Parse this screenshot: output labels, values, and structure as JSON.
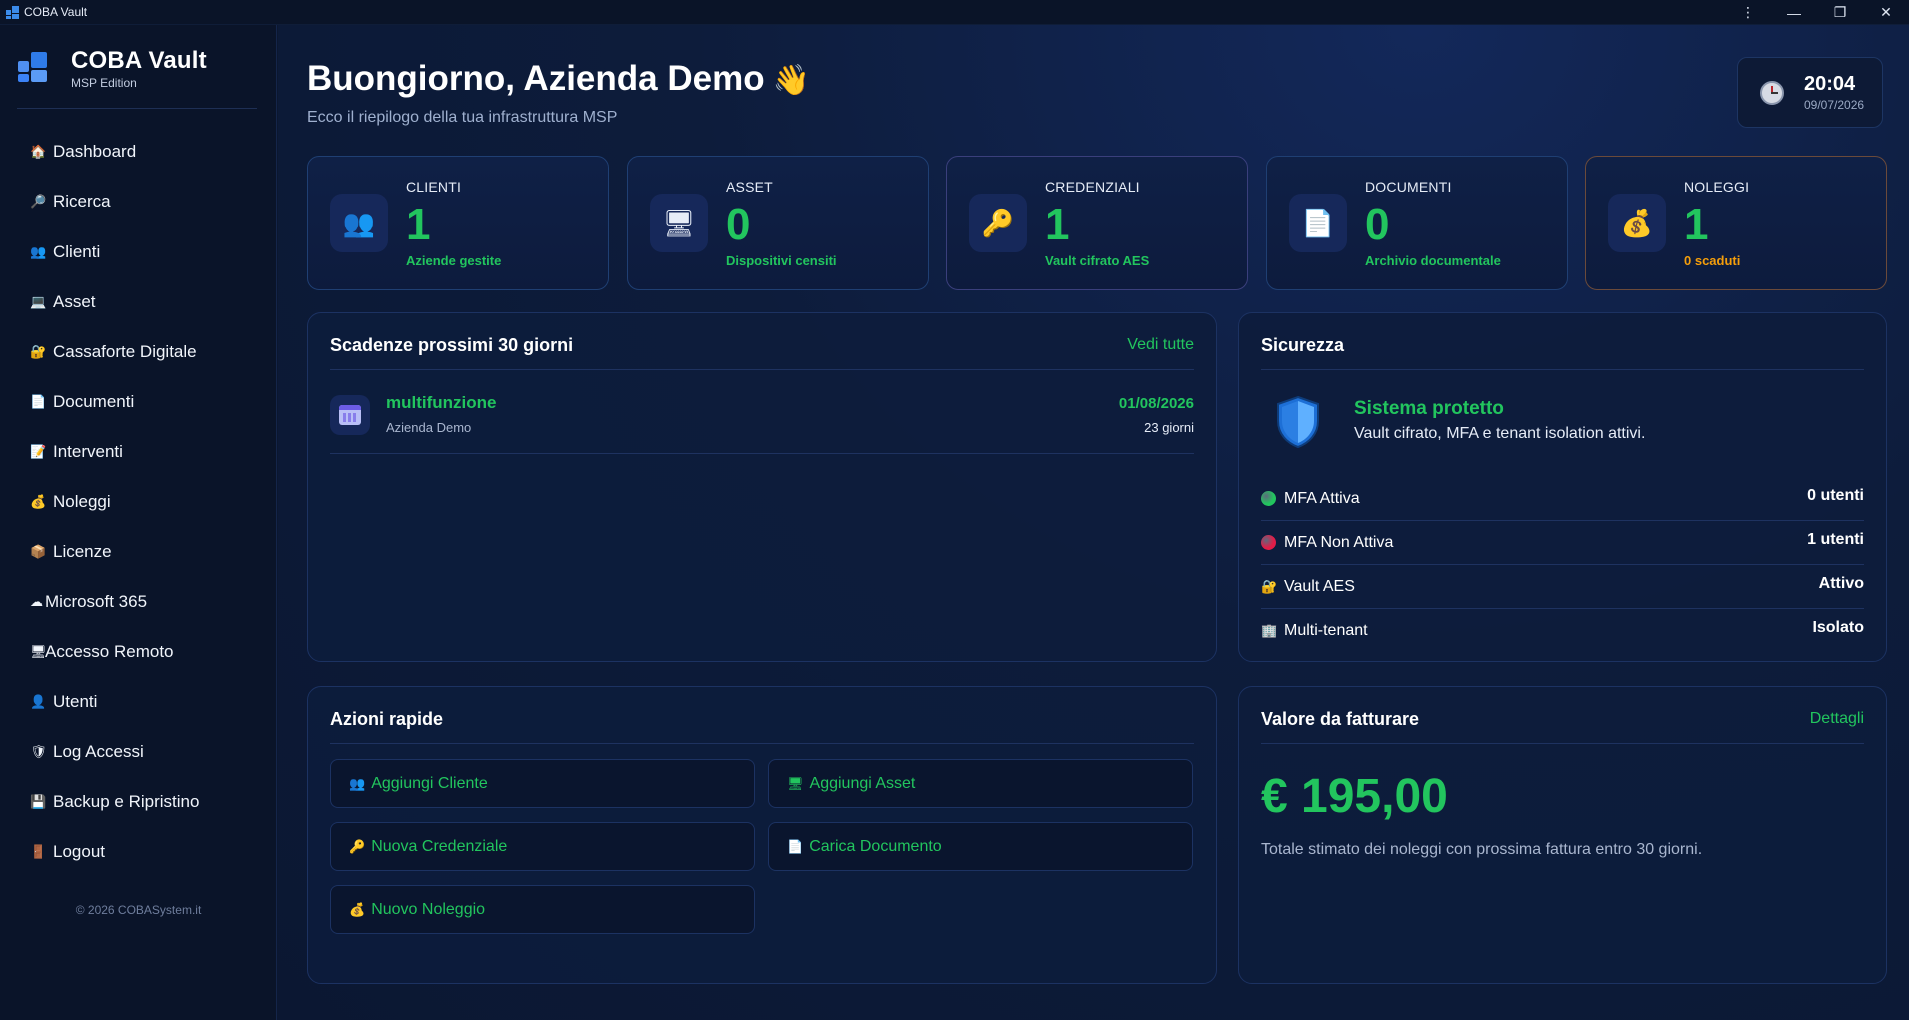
{
  "window": {
    "title": "COBA Vault",
    "controls": [
      {
        "name": "more-options-icon",
        "glyph": "⋮"
      },
      {
        "name": "minimize-icon",
        "glyph": "—"
      },
      {
        "name": "restore-icon",
        "glyph": "❐"
      },
      {
        "name": "close-icon",
        "glyph": "✕"
      }
    ]
  },
  "sidebar": {
    "brand_name": "COBA Vault",
    "brand_edition": "MSP Edition",
    "items": [
      {
        "label": "Dashboard",
        "icon": "🏠",
        "icon_name": "house-icon"
      },
      {
        "label": "Ricerca",
        "icon": "🔎",
        "icon_name": "search-icon"
      },
      {
        "label": "Clienti",
        "icon": "👥",
        "icon_name": "users-icon"
      },
      {
        "label": "Asset",
        "icon": "💻",
        "icon_name": "laptop-icon"
      },
      {
        "label": "Cassaforte Digitale",
        "icon": "🔐",
        "icon_name": "lock-icon"
      },
      {
        "label": "Documenti",
        "icon": "📄",
        "icon_name": "document-icon"
      },
      {
        "label": "Interventi",
        "icon": "📝",
        "icon_name": "memo-icon"
      },
      {
        "label": "Noleggi",
        "icon": "💰",
        "icon_name": "money-bag-icon"
      },
      {
        "label": "Licenze",
        "icon": "📦",
        "icon_name": "package-icon"
      },
      {
        "label": "Microsoft 365",
        "icon": "☁",
        "icon_name": "cloud-icon"
      },
      {
        "label": "Accesso Remoto",
        "icon": "🖥",
        "icon_name": "desktop-icon"
      },
      {
        "label": "Utenti",
        "icon": "👤",
        "icon_name": "user-icon"
      },
      {
        "label": "Log Accessi",
        "icon": "🛡",
        "icon_name": "shield-icon"
      },
      {
        "label": "Backup e Ripristino",
        "icon": "💾",
        "icon_name": "floppy-disk-icon"
      },
      {
        "label": "Logout",
        "icon": "🚪",
        "icon_name": "door-icon"
      }
    ],
    "footer": "© 2026 COBASystem.it"
  },
  "header": {
    "greeting": "Buongiorno, Azienda Demo",
    "wave": "👋",
    "subtitle": "Ecco il riepilogo della tua infrastruttura MSP",
    "clock_time": "20:04",
    "clock_date": "09/07/2026"
  },
  "stats": [
    {
      "label": "CLIENTI",
      "value": "1",
      "sub": "Aziende gestite",
      "icon": "👥",
      "icon_name": "users-icon",
      "variant": "",
      "sub_variant": ""
    },
    {
      "label": "ASSET",
      "value": "0",
      "sub": "Dispositivi censiti",
      "icon": "🖥",
      "icon_name": "desktop-icon",
      "variant": "",
      "sub_variant": ""
    },
    {
      "label": "CREDENZIALI",
      "value": "1",
      "sub": "Vault cifrato AES",
      "icon": "🔑",
      "icon_name": "key-icon",
      "variant": "violet",
      "sub_variant": ""
    },
    {
      "label": "DOCUMENTI",
      "value": "0",
      "sub": "Archivio documentale",
      "icon": "📄",
      "icon_name": "document-icon",
      "variant": "",
      "sub_variant": ""
    },
    {
      "label": "NOLEGGI",
      "value": "1",
      "sub": "0 scaduti",
      "icon": "💰",
      "icon_name": "money-bag-icon",
      "variant": "orange",
      "sub_variant": "warn"
    }
  ],
  "deadlines": {
    "title": "Scadenze prossimi 30 giorni",
    "link": "Vedi tutte",
    "items": [
      {
        "name": "multifunzione",
        "client": "Azienda Demo",
        "date": "01/08/2026",
        "days": "23 giorni"
      }
    ]
  },
  "security": {
    "title": "Sicurezza",
    "status_title": "Sistema protetto",
    "status_desc": "Vault cifrato, MFA e tenant isolation attivi.",
    "rows": [
      {
        "label": "MFA Attiva",
        "value": "0 utenti",
        "marker": "dot",
        "color": "#22c55e",
        "icon_name": "green-dot-icon"
      },
      {
        "label": "MFA Non Attiva",
        "value": "1 utenti",
        "marker": "dot",
        "color": "#e11d48",
        "icon_name": "red-dot-icon"
      },
      {
        "label": "Vault AES",
        "value": "Attivo",
        "marker": "🔐",
        "icon_name": "lock-icon"
      },
      {
        "label": "Multi-tenant",
        "value": "Isolato",
        "marker": "🏢",
        "icon_name": "building-icon"
      }
    ]
  },
  "quick_actions": {
    "title": "Azioni rapide",
    "buttons": [
      {
        "label": "Aggiungi Cliente",
        "icon": "👥",
        "icon_name": "users-icon"
      },
      {
        "label": "Aggiungi Asset",
        "icon": "🖥",
        "icon_name": "desktop-icon"
      },
      {
        "label": "Nuova Credenziale",
        "icon": "🔑",
        "icon_name": "key-icon"
      },
      {
        "label": "Carica Documento",
        "icon": "📄",
        "icon_name": "document-icon"
      },
      {
        "label": "Nuovo Noleggio",
        "icon": "💰",
        "icon_name": "money-bag-icon"
      }
    ]
  },
  "billing": {
    "title": "Valore da fatturare",
    "link": "Dettagli",
    "amount": "€ 195,00",
    "note": "Totale stimato dei noleggi con prossima fattura entro 30 giorni."
  },
  "colors": {
    "accent": "#22c55e",
    "warning": "#f59e0b",
    "danger": "#e11d48",
    "background": "#0b1730"
  }
}
